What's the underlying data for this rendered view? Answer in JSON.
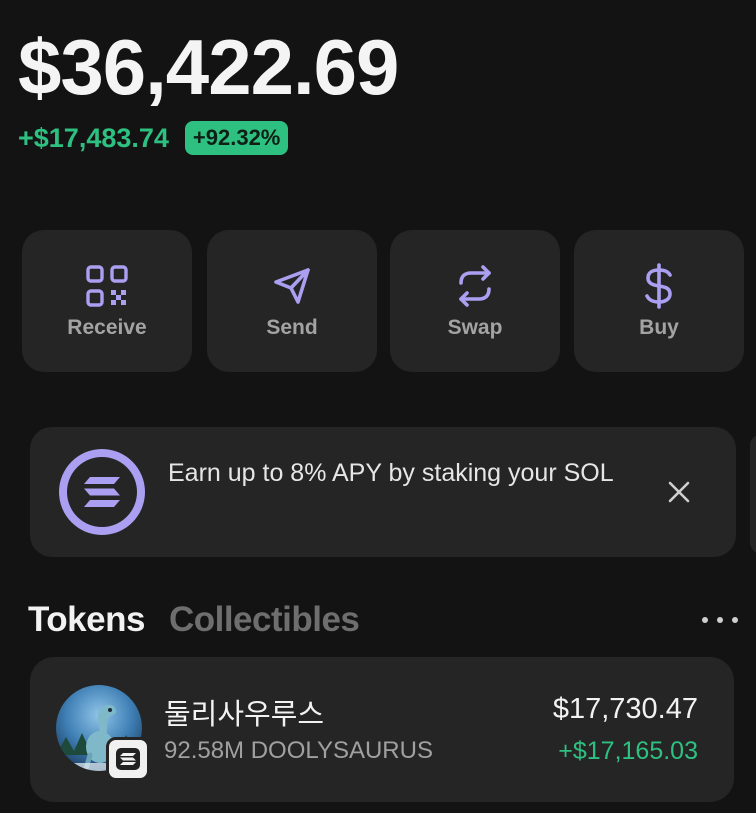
{
  "portfolio": {
    "balance": "$36,422.69",
    "change_amount": "+$17,483.74",
    "change_percent": "+92.32%"
  },
  "actions": [
    {
      "label": "Receive",
      "icon": "qr-code-icon"
    },
    {
      "label": "Send",
      "icon": "send-icon"
    },
    {
      "label": "Swap",
      "icon": "swap-icon"
    },
    {
      "label": "Buy",
      "icon": "dollar-icon"
    }
  ],
  "banner": {
    "text": "Earn up to 8% APY by staking your SOL",
    "icon": "solana-icon",
    "close_icon": "close-icon"
  },
  "tabs": [
    {
      "label": "Tokens",
      "active": true
    },
    {
      "label": "Collectibles",
      "active": false
    }
  ],
  "more_icon": "more-icon",
  "tokens": [
    {
      "name": "둘리사우루스",
      "amount": "92.58M DOOLYSAURUS",
      "value": "$17,730.47",
      "change": "+$17,165.03"
    }
  ],
  "colors": {
    "background": "#131313",
    "card": "#252525",
    "accent": "#ab9ff2",
    "positive": "#2ec081"
  }
}
